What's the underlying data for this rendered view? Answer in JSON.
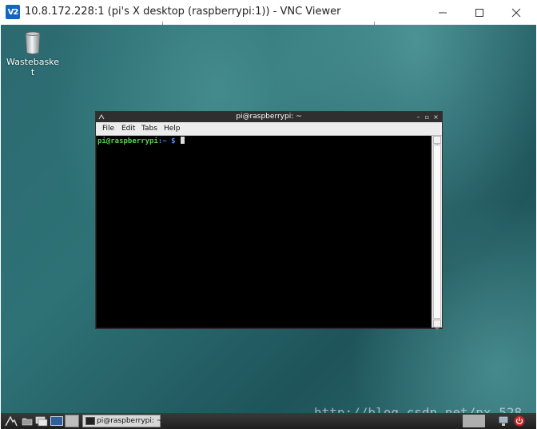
{
  "vnc_window": {
    "title": "10.8.172.228:1 (pi's X desktop (raspberrypi:1)) - VNC Viewer",
    "logo_text": "V2",
    "controls": [
      "minimize",
      "maximize",
      "close"
    ]
  },
  "desktop": {
    "icons": [
      {
        "label": "Wastebasket",
        "icon": "trash-bin-icon"
      }
    ]
  },
  "terminal": {
    "title": "pi@raspberrypi: ~",
    "wm_buttons": [
      "–",
      "▫",
      "×"
    ],
    "menu": [
      "File",
      "Edit",
      "Tabs",
      "Help"
    ],
    "prompt_user": "pi@raspberrypi",
    "prompt_path": ":~ $",
    "colors": {
      "prompt_user": "#4fd64f",
      "prompt_path": "#5a8cff",
      "background": "#000000"
    }
  },
  "taskbar": {
    "task_label": "pi@raspberrypi: ~",
    "launchers": [
      "menu-icon",
      "file-manager-icon",
      "terminal-icon",
      "desktop-icon"
    ]
  },
  "watermark": "http://blog.csdn.net/px_528"
}
